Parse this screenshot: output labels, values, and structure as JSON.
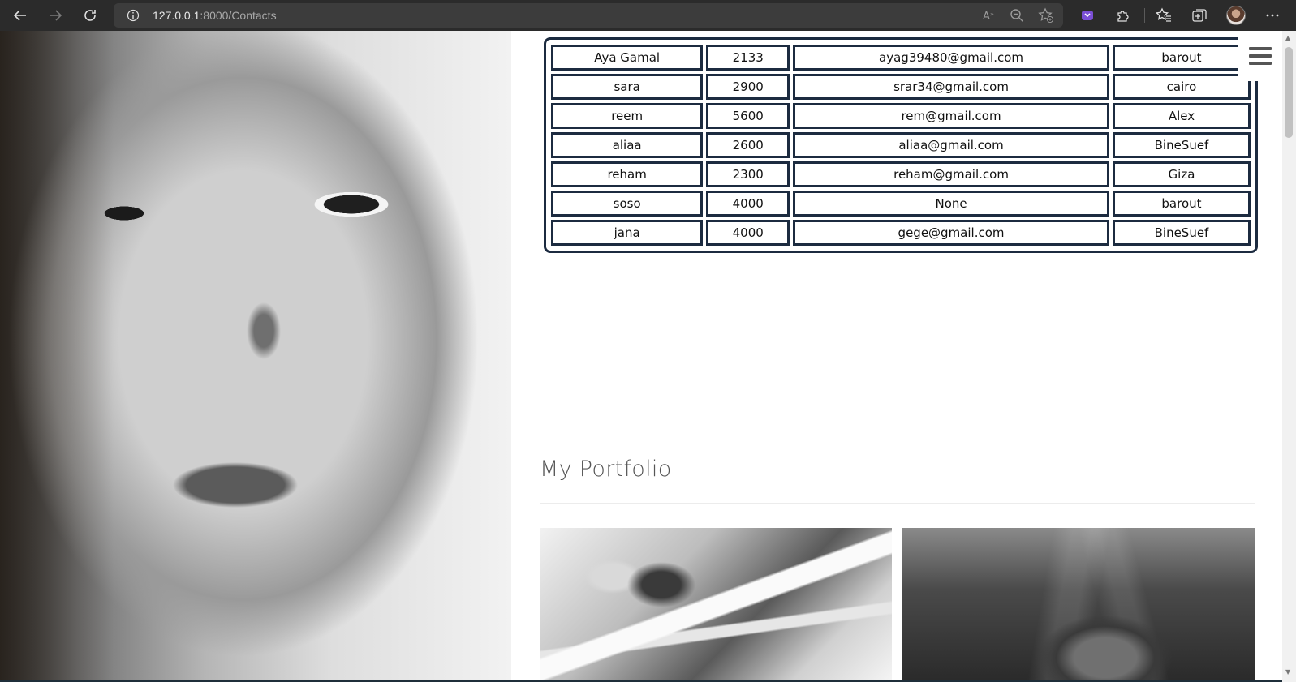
{
  "browser": {
    "url_host": "127.0.0.1",
    "url_rest": ":8000/Contacts",
    "icons": [
      "back-icon",
      "forward-icon",
      "refresh-icon",
      "site-info-icon",
      "read-aloud-icon",
      "zoom-out-icon",
      "add-favorite-icon",
      "extension-icon",
      "puzzle-icon",
      "favorites-icon",
      "collections-icon",
      "profile-avatar",
      "more-icon"
    ]
  },
  "contacts_table": {
    "rows": [
      {
        "name": "Aya Gamal",
        "phone": "2133",
        "email": "ayag39480@gmail.com",
        "city": "barout"
      },
      {
        "name": "sara",
        "phone": "2900",
        "email": "srar34@gmail.com",
        "city": "cairo"
      },
      {
        "name": "reem",
        "phone": "5600",
        "email": "rem@gmail.com",
        "city": "Alex"
      },
      {
        "name": "aliaa",
        "phone": "2600",
        "email": "aliaa@gmail.com",
        "city": "BineSuef"
      },
      {
        "name": "reham",
        "phone": "2300",
        "email": "reham@gmail.com",
        "city": "Giza"
      },
      {
        "name": "soso",
        "phone": "4000",
        "email": "None",
        "city": "barout"
      },
      {
        "name": "jana",
        "phone": "4000",
        "email": "gege@gmail.com",
        "city": "BineSuef"
      }
    ]
  },
  "portfolio": {
    "title": "My Portfolio"
  },
  "colors": {
    "table_border": "#1c2b40",
    "toolbar_bg": "#2b2b2b",
    "heading": "#555555"
  }
}
